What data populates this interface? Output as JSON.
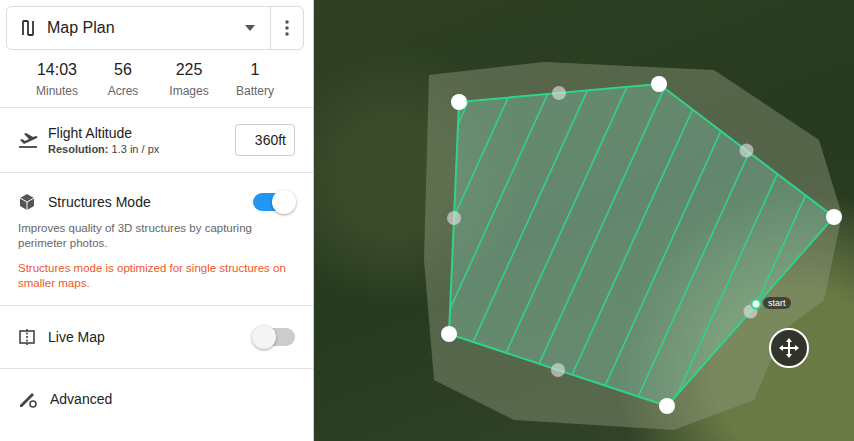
{
  "header": {
    "title": "Map Plan"
  },
  "stats": [
    {
      "value": "14:03",
      "label": "Minutes"
    },
    {
      "value": "56",
      "label": "Acres"
    },
    {
      "value": "225",
      "label": "Images"
    },
    {
      "value": "1",
      "label": "Battery"
    }
  ],
  "altitude": {
    "label": "Flight Altitude",
    "resolution_label": "Resolution:",
    "resolution": "1.3 in / px",
    "value": "360ft"
  },
  "structures": {
    "label": "Structures Mode",
    "on": true,
    "description": "Improves quality of 3D structures by capturing perimeter photos.",
    "warning": "Structures mode is optimized for single structures on smaller maps."
  },
  "live_map": {
    "label": "Live Map",
    "on": false
  },
  "advanced": {
    "label": "Advanced"
  },
  "map": {
    "start_label": "start"
  }
}
